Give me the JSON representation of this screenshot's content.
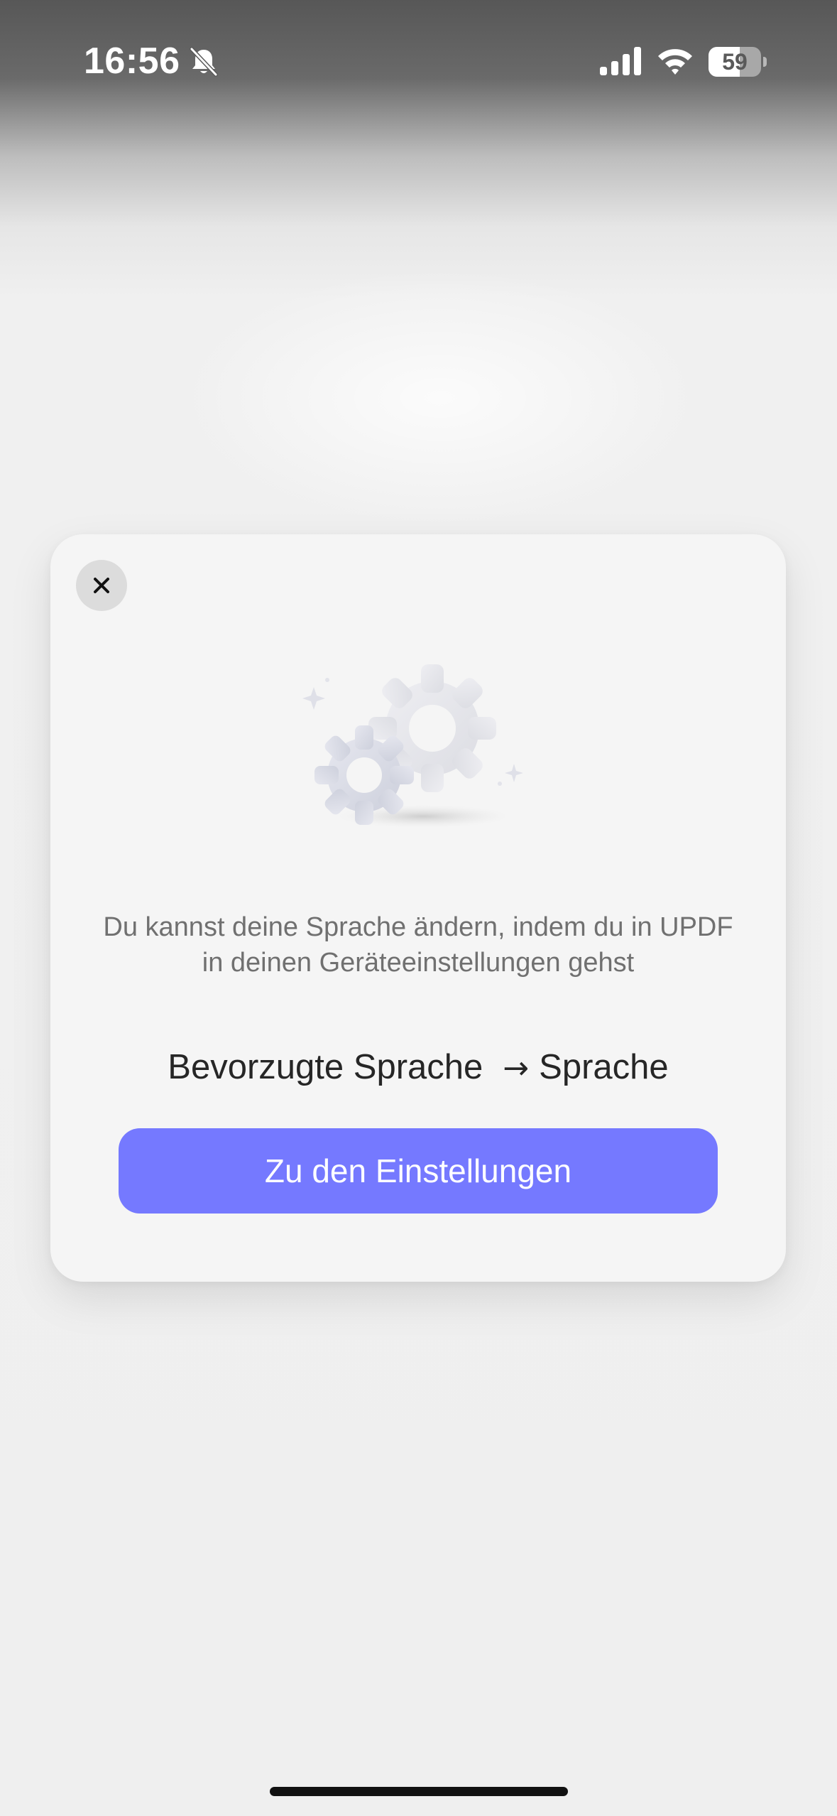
{
  "status_bar": {
    "time": "16:56",
    "battery_percent": "59",
    "battery_level": 0.59,
    "icons": [
      "bell-slash-icon",
      "cellular-signal-icon",
      "wifi-icon",
      "battery-icon"
    ]
  },
  "dialog": {
    "close_icon": "close-icon",
    "illustration_icon": "gears-icon",
    "message": "Du kannst deine Sprache ändern, indem du in UPDF in deinen Geräteeinstellungen gehst",
    "path_from": "Bevorzugte Sprache",
    "path_arrow": "→",
    "path_to": "Sprache",
    "button_label": "Zu den Einstellungen"
  },
  "colors": {
    "accent": "#7579FF",
    "card_background": "#F5F5F5",
    "message_text": "#707070",
    "path_text": "#262626"
  }
}
